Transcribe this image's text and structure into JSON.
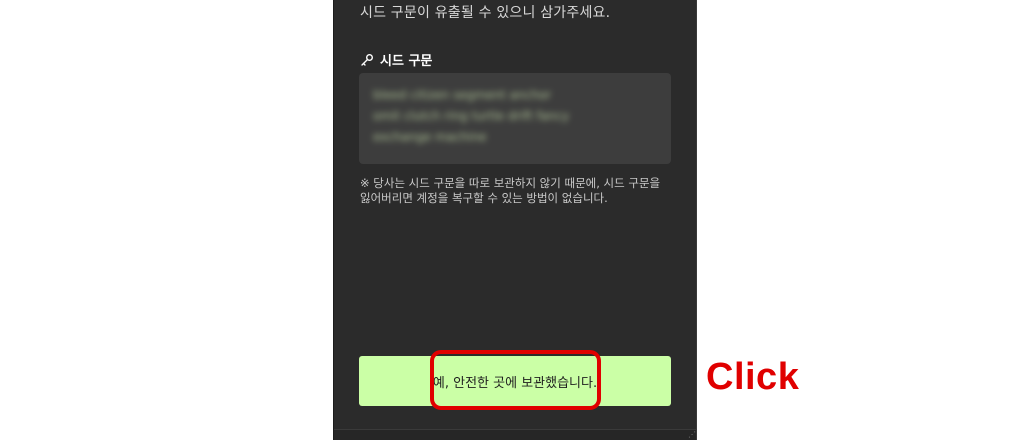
{
  "panel": {
    "top_warning": "시드 구문이 유출될 수 있으니 삼가주세요.",
    "seed_section": {
      "label": "시드 구문",
      "icon": "key-icon",
      "seed_blurred_lines": [
        "bleed citizen segment anchor",
        "omit clutch ring turtle drift fancy",
        "exchange machine"
      ]
    },
    "notice": "※ 당사는 시드 구문을 따로 보관하지 않기 때문에, 시드 구문을 잃어버리면 계정을 복구할 수 있는 방법이 없습니다.",
    "confirm_button": "예, 안전한 곳에 보관했습니다."
  },
  "annotation": {
    "label": "Click",
    "color": "#e00000"
  },
  "colors": {
    "panel_bg": "#2b2b2b",
    "seed_box_bg": "#3d3d3d",
    "button_bg": "#cbffa6",
    "highlight": "#e00000"
  }
}
